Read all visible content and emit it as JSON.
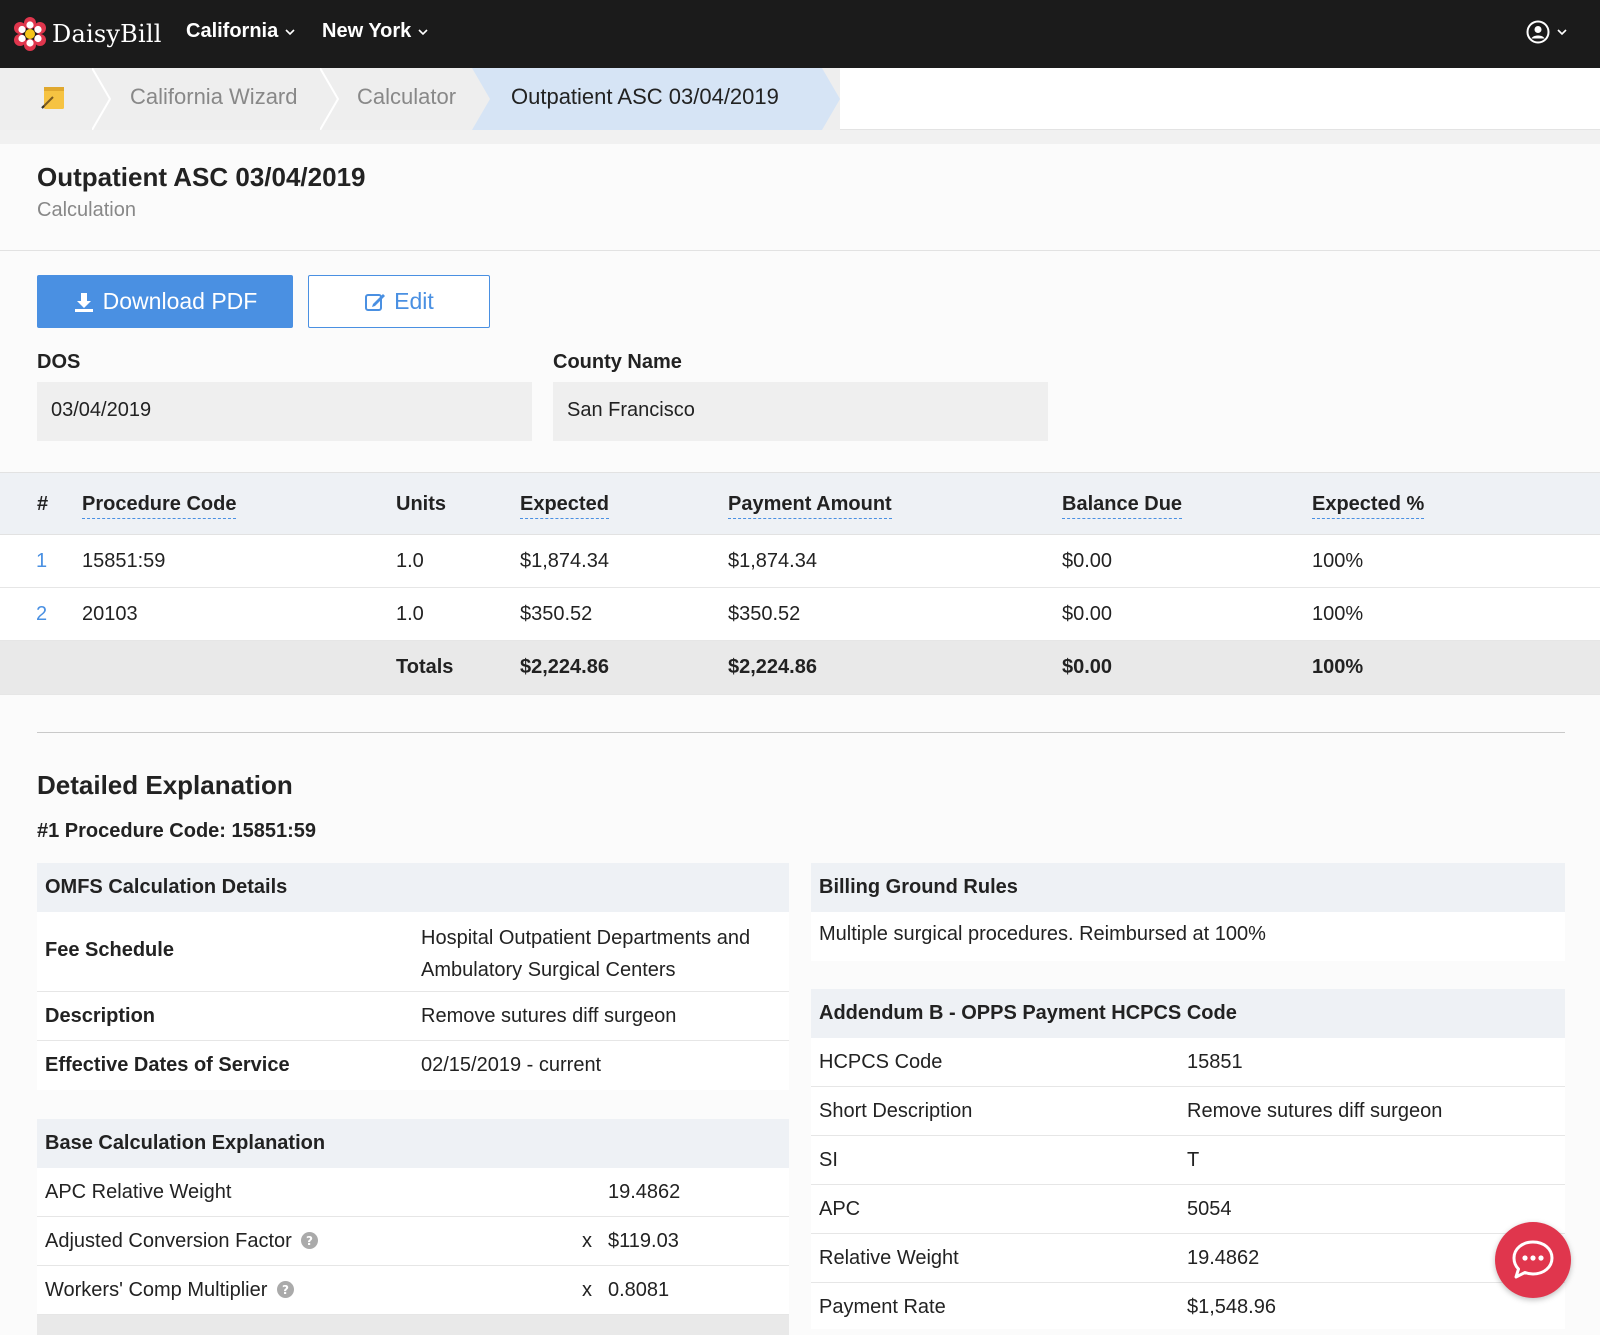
{
  "app": {
    "brand": "DaisyBill",
    "nav": [
      {
        "label": "California"
      },
      {
        "label": "New York"
      }
    ]
  },
  "breadcrumb": {
    "items": [
      "California Wizard",
      "Calculator",
      "Outpatient ASC 03/04/2019"
    ]
  },
  "page": {
    "title": "Outpatient ASC 03/04/2019",
    "subtitle": "Calculation"
  },
  "actions": {
    "download_label": "Download PDF",
    "edit_label": "Edit"
  },
  "fields": {
    "dos": {
      "label": "DOS",
      "value": "03/04/2019"
    },
    "county": {
      "label": "County Name",
      "value": "San Francisco"
    }
  },
  "table": {
    "headers": [
      "#",
      "Procedure Code",
      "Units",
      "Expected",
      "Payment Amount",
      "Balance Due",
      "Expected %"
    ],
    "rows": [
      {
        "num": "1",
        "code": "15851:59",
        "units": "1.0",
        "expected": "$1,874.34",
        "payment": "$1,874.34",
        "balance": "$0.00",
        "pct": "100%"
      },
      {
        "num": "2",
        "code": "20103",
        "units": "1.0",
        "expected": "$350.52",
        "payment": "$350.52",
        "balance": "$0.00",
        "pct": "100%"
      }
    ],
    "totals": {
      "label": "Totals",
      "expected": "$2,224.86",
      "payment": "$2,224.86",
      "balance": "$0.00",
      "pct": "100%"
    }
  },
  "details": {
    "title": "Detailed Explanation",
    "procedure_heading": "#1 Procedure Code: 15851:59",
    "omfs": {
      "title": "OMFS Calculation Details",
      "rows": [
        {
          "key": "Fee Schedule",
          "value_line1": "Hospital Outpatient Departments and",
          "value_line2": "Ambulatory Surgical Centers"
        },
        {
          "key": "Description",
          "value": "Remove sutures diff surgeon"
        },
        {
          "key": "Effective Dates of Service",
          "value": "02/15/2019 - current"
        }
      ]
    },
    "base": {
      "title": "Base Calculation Explanation",
      "rows": [
        {
          "key": "APC Relative Weight",
          "op": "",
          "value": "19.4862"
        },
        {
          "key": "Adjusted Conversion Factor",
          "op": "x",
          "value": "$119.03"
        },
        {
          "key": "Workers' Comp Multiplier",
          "op": "x",
          "value": "0.8081"
        }
      ]
    },
    "billing": {
      "title": "Billing Ground Rules",
      "text": "Multiple surgical procedures. Reimbursed at 100%"
    },
    "addendum": {
      "title": "Addendum B - OPPS Payment HCPCS Code",
      "rows": [
        {
          "key": "HCPCS Code",
          "value": "15851"
        },
        {
          "key": "Short Description",
          "value": "Remove sutures diff surgeon"
        },
        {
          "key": "SI",
          "value": "T"
        },
        {
          "key": "APC",
          "value": "5054"
        },
        {
          "key": "Relative Weight",
          "value": "19.4862"
        },
        {
          "key": "Payment Rate",
          "value": "$1,548.96"
        }
      ]
    }
  },
  "icons": {
    "logo": "daisy-flower-icon",
    "user": "user-circle-icon",
    "home": "notepad-icon",
    "download": "download-icon",
    "edit": "edit-icon",
    "help": "question-circle-icon",
    "chat": "chat-bubble-icon"
  },
  "colors": {
    "topbar": "#1b1b1b",
    "accent": "#4a90e2",
    "chat": "#e0364d",
    "active_crumb": "#d6e4f5"
  }
}
